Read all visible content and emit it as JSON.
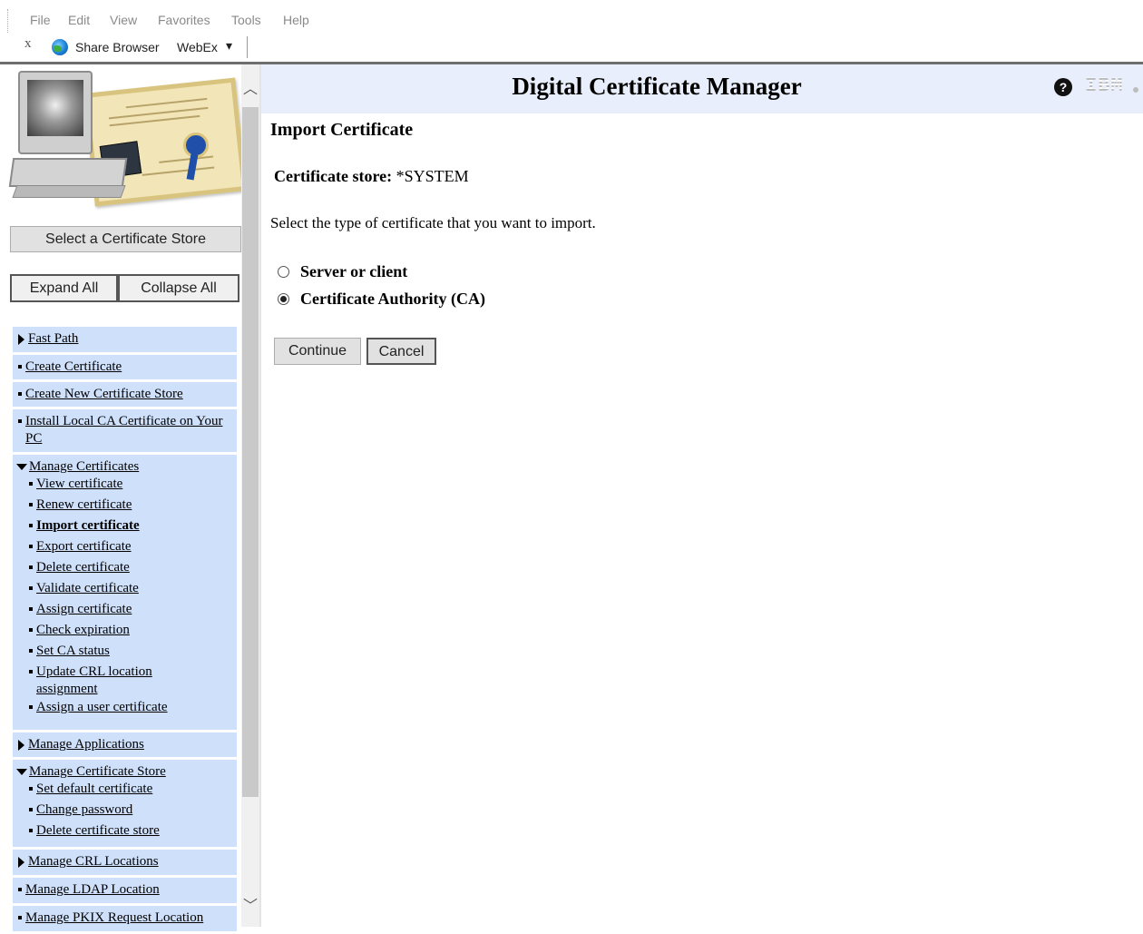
{
  "browser": {
    "menu": [
      "File",
      "Edit",
      "View",
      "Favorites",
      "Tools",
      "Help"
    ],
    "toolbar": {
      "close_glyph": "x",
      "share_browser": "Share Browser",
      "webex": "WebEx",
      "webex_dropdown_glyph": "▾"
    }
  },
  "sidebar": {
    "select_store_button": "Select a Certificate Store",
    "expand_all_button": "Expand All",
    "collapse_all_button": "Collapse All",
    "scroll_up_glyph": "︿",
    "scroll_down_glyph": "﹀",
    "nav": {
      "fast_path": "Fast Path",
      "create_certificate": "Create Certificate",
      "create_new_store": "Create New Certificate Store",
      "install_local_ca": "Install Local CA Certificate on Your PC",
      "manage_certificates": {
        "label": "Manage Certificates",
        "items": [
          "View certificate",
          "Renew certificate",
          "Import certificate",
          "Export certificate",
          "Delete certificate",
          "Validate certificate",
          "Assign certificate",
          "Check expiration",
          "Set CA status",
          "Update CRL location assignment",
          "Assign a user certificate"
        ]
      },
      "manage_applications": "Manage Applications",
      "manage_certificate_store": {
        "label": "Manage Certificate Store",
        "items": [
          "Set default certificate",
          "Change password",
          "Delete certificate store"
        ]
      },
      "manage_crl_locations": "Manage CRL Locations",
      "manage_ldap_location": "Manage LDAP Location",
      "manage_pkix_location": "Manage PKIX Request Location"
    }
  },
  "header": {
    "title": "Digital Certificate Manager",
    "help_glyph": "?",
    "logo_text": "IBM"
  },
  "main": {
    "page_title": "Import Certificate",
    "store_label": "Certificate store:",
    "store_value": "*SYSTEM",
    "instruction": "Select the type of certificate that you want to import.",
    "options": [
      {
        "label": "Server or client",
        "selected": false
      },
      {
        "label": "Certificate Authority (CA)",
        "selected": true
      }
    ],
    "continue_button": "Continue",
    "cancel_button": "Cancel"
  }
}
